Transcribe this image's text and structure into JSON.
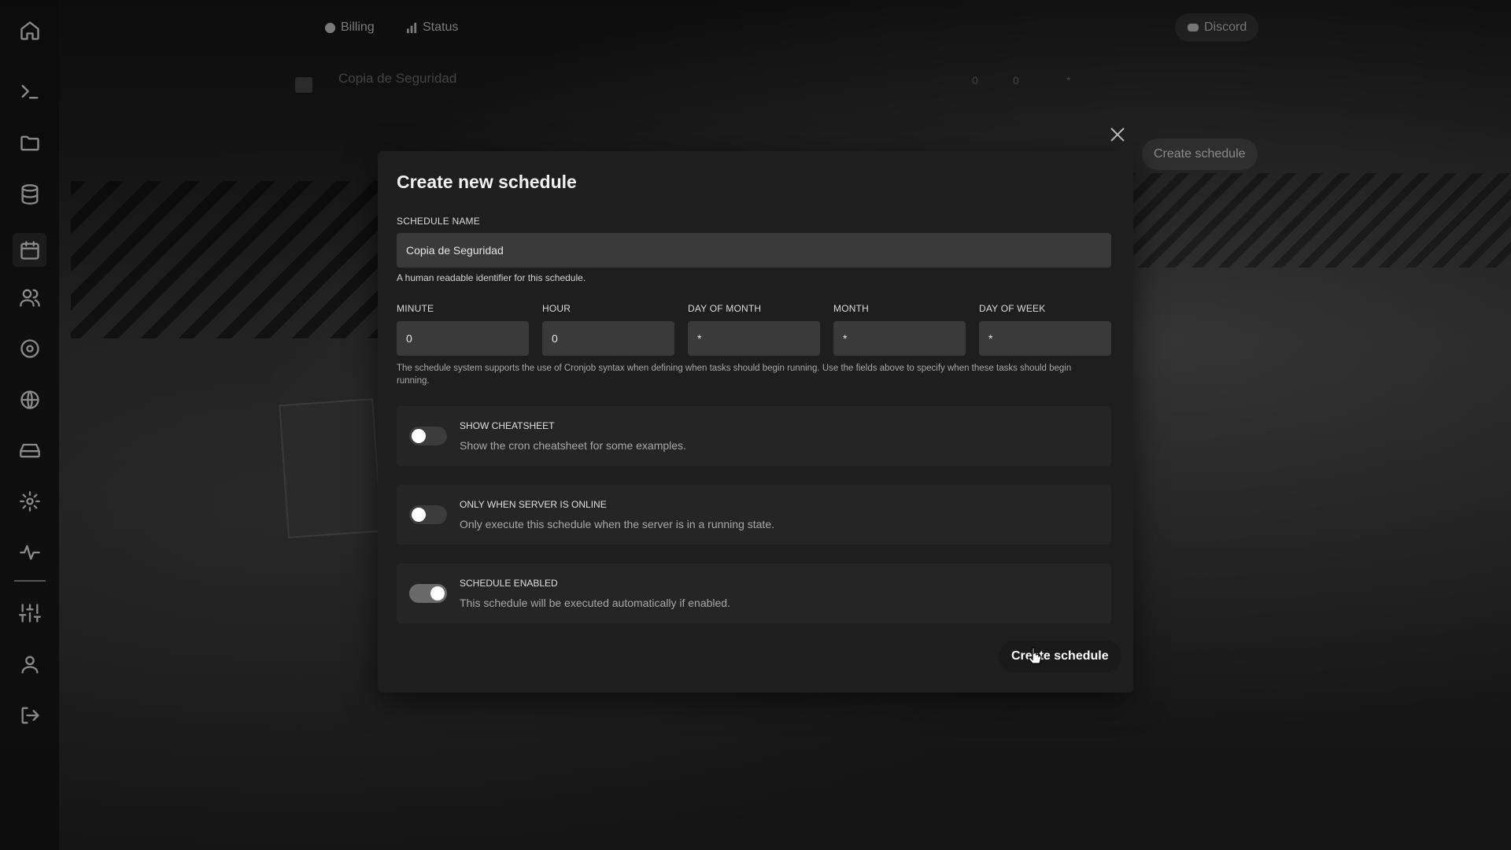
{
  "topnav": {
    "billing": "Billing",
    "status": "Status",
    "discord": "Discord"
  },
  "background": {
    "schedule_row_name": "Copia de Seguridad",
    "row_values": [
      "0",
      "0",
      "*"
    ],
    "create_button": "Create schedule"
  },
  "sidebar": {
    "items": [
      {
        "icon": "home-icon"
      },
      {
        "icon": "terminal-icon"
      },
      {
        "icon": "folder-icon"
      },
      {
        "icon": "database-icon"
      },
      {
        "icon": "calendar-icon",
        "active": true
      },
      {
        "icon": "users-icon"
      },
      {
        "icon": "disc-icon"
      },
      {
        "icon": "globe-icon"
      },
      {
        "icon": "hard-drive-icon"
      },
      {
        "icon": "settings-icon"
      },
      {
        "icon": "activity-icon"
      },
      {
        "icon": "sliders-icon"
      },
      {
        "icon": "user-icon"
      },
      {
        "icon": "logout-icon"
      }
    ]
  },
  "modal": {
    "title": "Create new schedule",
    "schedule_name": {
      "label": "SCHEDULE NAME",
      "value": "Copia de Seguridad",
      "help": "A human readable identifier for this schedule."
    },
    "cron": {
      "minute": {
        "label": "MINUTE",
        "value": "0"
      },
      "hour": {
        "label": "HOUR",
        "value": "0"
      },
      "day_of_month": {
        "label": "DAY OF MONTH",
        "value": "*"
      },
      "month": {
        "label": "MONTH",
        "value": "*"
      },
      "day_of_week": {
        "label": "DAY OF WEEK",
        "value": "*"
      },
      "help": "The schedule system supports the use of Cronjob syntax when defining when tasks should begin running. Use the fields above to specify when these tasks should begin running."
    },
    "options": {
      "cheatsheet": {
        "title": "SHOW CHEATSHEET",
        "desc": "Show the cron cheatsheet for some examples.",
        "enabled": false
      },
      "online_only": {
        "title": "ONLY WHEN SERVER IS ONLINE",
        "desc": "Only execute this schedule when the server is in a running state.",
        "enabled": false
      },
      "schedule_enabled": {
        "title": "SCHEDULE ENABLED",
        "desc": "This schedule will be executed automatically if enabled.",
        "enabled": true
      }
    },
    "submit_label": "Create schedule"
  }
}
